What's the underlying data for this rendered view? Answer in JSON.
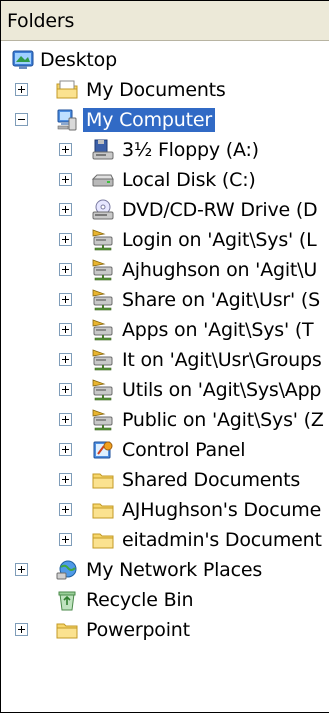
{
  "header": {
    "title": "Folders"
  },
  "tree": {
    "desktop": "Desktop",
    "my_documents": "My Documents",
    "my_computer": "My Computer",
    "floppy": "3½ Floppy (A:)",
    "local_disk": "Local Disk (C:)",
    "dvd": "DVD/CD-RW Drive (D",
    "login": "Login on 'Agit\\Sys' (L",
    "ajhughson": "Ajhughson on 'Agit\\U",
    "share": "Share on 'Agit\\Usr' (S",
    "apps": "Apps on 'Agit\\Sys' (T",
    "it": "It on 'Agit\\Usr\\Groups",
    "utils": "Utils on 'Agit\\Sys\\App",
    "public": "Public on 'Agit\\Sys' (Z",
    "control_panel": "Control Panel",
    "shared_documents": "Shared Documents",
    "ajhughson_docs": "AJHughson's Docume",
    "eitadmin_docs": "eitadmin's Document",
    "network_places": "My Network Places",
    "recycle_bin": "Recycle Bin",
    "powerpoint": "Powerpoint"
  },
  "colors": {
    "selection": "#316ac5",
    "header_bg": "#ece9d8"
  }
}
